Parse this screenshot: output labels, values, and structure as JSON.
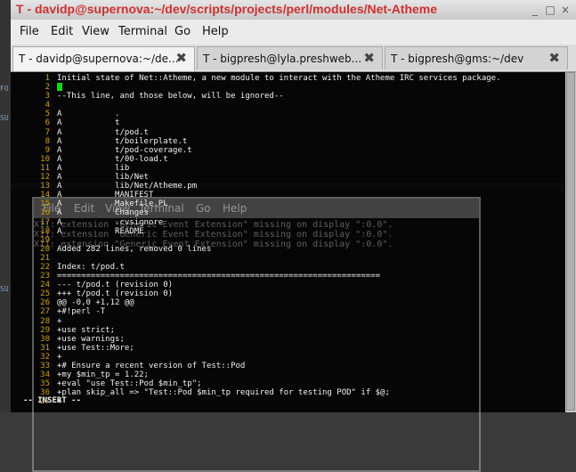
{
  "window": {
    "title": "T - davidp@supernova:~/dev/scripts/projects/perl/modules/Net-Atheme",
    "controls": [
      "_",
      "□",
      "×"
    ]
  },
  "menu": [
    "File",
    "Edit",
    "View",
    "Terminal",
    "Go",
    "Help"
  ],
  "tabs": [
    {
      "label": "T - davidp@supernova:~/de...",
      "active": true
    },
    {
      "label": "T - bigpresh@lyla.preshweb...",
      "active": false
    },
    {
      "label": "T - bigpresh@gms:~/dev",
      "active": false
    }
  ],
  "ghost": {
    "menu": [
      "File",
      "Edit",
      "View",
      "Terminal",
      "Go",
      "Help"
    ],
    "errors": [
      "X11: extension \"Generic Event Extension\" missing on display \":0.0\".",
      "X11: extension \"Generic Event Extension\" missing on display \":0.0\".",
      "X11: extension \"Generic Event Extension\" missing on display \":0.0\"."
    ]
  },
  "editor": {
    "lines": [
      {
        "n": "1",
        "t": "Initial state of Net::Atheme, a new module to interact with the Atheme IRC services package."
      },
      {
        "n": "2",
        "t": "",
        "cursor": true
      },
      {
        "n": "3",
        "t": "--This line, and those below, will be ignored--"
      },
      {
        "n": "4",
        "t": ""
      },
      {
        "n": "5",
        "t": "A           ."
      },
      {
        "n": "6",
        "t": "A           t"
      },
      {
        "n": "7",
        "t": "A           t/pod.t"
      },
      {
        "n": "8",
        "t": "A           t/boilerplate.t"
      },
      {
        "n": "9",
        "t": "A           t/pod-coverage.t"
      },
      {
        "n": "10",
        "t": "A           t/00-load.t"
      },
      {
        "n": "11",
        "t": "A           lib"
      },
      {
        "n": "12",
        "t": "A           lib/Net"
      },
      {
        "n": "13",
        "t": "A           lib/Net/Atheme.pm"
      },
      {
        "n": "14",
        "t": "A           MANIFEST"
      },
      {
        "n": "15",
        "t": "A           Makefile.PL"
      },
      {
        "n": "16",
        "t": "A           Changes"
      },
      {
        "n": "17",
        "t": "A           .cvsignore"
      },
      {
        "n": "18",
        "t": "A           README"
      },
      {
        "n": "19",
        "t": ""
      },
      {
        "n": "20",
        "t": "Added 282 lines, removed 0 lines"
      },
      {
        "n": "21",
        "t": ""
      },
      {
        "n": "22",
        "t": "Index: t/pod.t"
      },
      {
        "n": "23",
        "t": "==================================================================="
      },
      {
        "n": "24",
        "t": "--- t/pod.t (revision 0)"
      },
      {
        "n": "25",
        "t": "+++ t/pod.t (revision 0)"
      },
      {
        "n": "26",
        "t": "@@ -0,0 +1,12 @@"
      },
      {
        "n": "27",
        "t": "+#!perl -T"
      },
      {
        "n": "28",
        "t": "+"
      },
      {
        "n": "29",
        "t": "+use strict;"
      },
      {
        "n": "30",
        "t": "+use warnings;"
      },
      {
        "n": "31",
        "t": "+use Test::More;"
      },
      {
        "n": "32",
        "t": "+"
      },
      {
        "n": "33",
        "t": "+# Ensure a recent version of Test::Pod"
      },
      {
        "n": "34",
        "t": "+my $min_tp = 1.22;"
      },
      {
        "n": "35",
        "t": "+eval \"use Test::Pod $min_tp\";"
      },
      {
        "n": "36",
        "t": "+plan skip_all => \"Test::Pod $min_tp required for testing POD\" if $@;"
      },
      {
        "n": "37",
        "t": "+"
      }
    ],
    "status": "-- INSERT --"
  }
}
